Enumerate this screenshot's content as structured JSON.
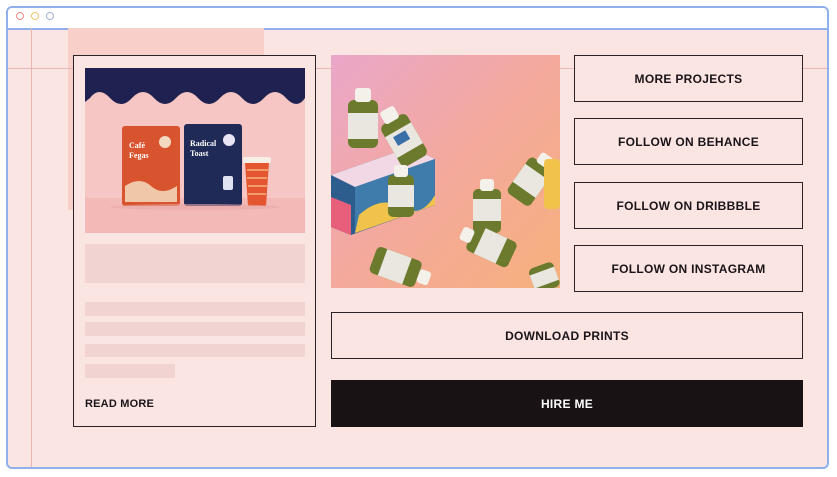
{
  "card": {
    "read_more": "READ MORE",
    "product_bag_1": "Café\nFegas",
    "product_bag_2": "Radical\nToast"
  },
  "actions": {
    "more_projects": "MORE PROJECTS",
    "follow_behance": "FOLLOW ON BEHANCE",
    "follow_dribbble": "FOLLOW ON DRIBBBLE",
    "follow_instagram": "FOLLOW ON INSTAGRAM",
    "download_prints": "DOWNLOAD PRINTS",
    "hire_me": "HIRE ME"
  },
  "colors": {
    "background": "#fbe5e3",
    "window_border": "#8fb0ea",
    "button_border": "#2a2226",
    "primary_button": "#181214"
  }
}
